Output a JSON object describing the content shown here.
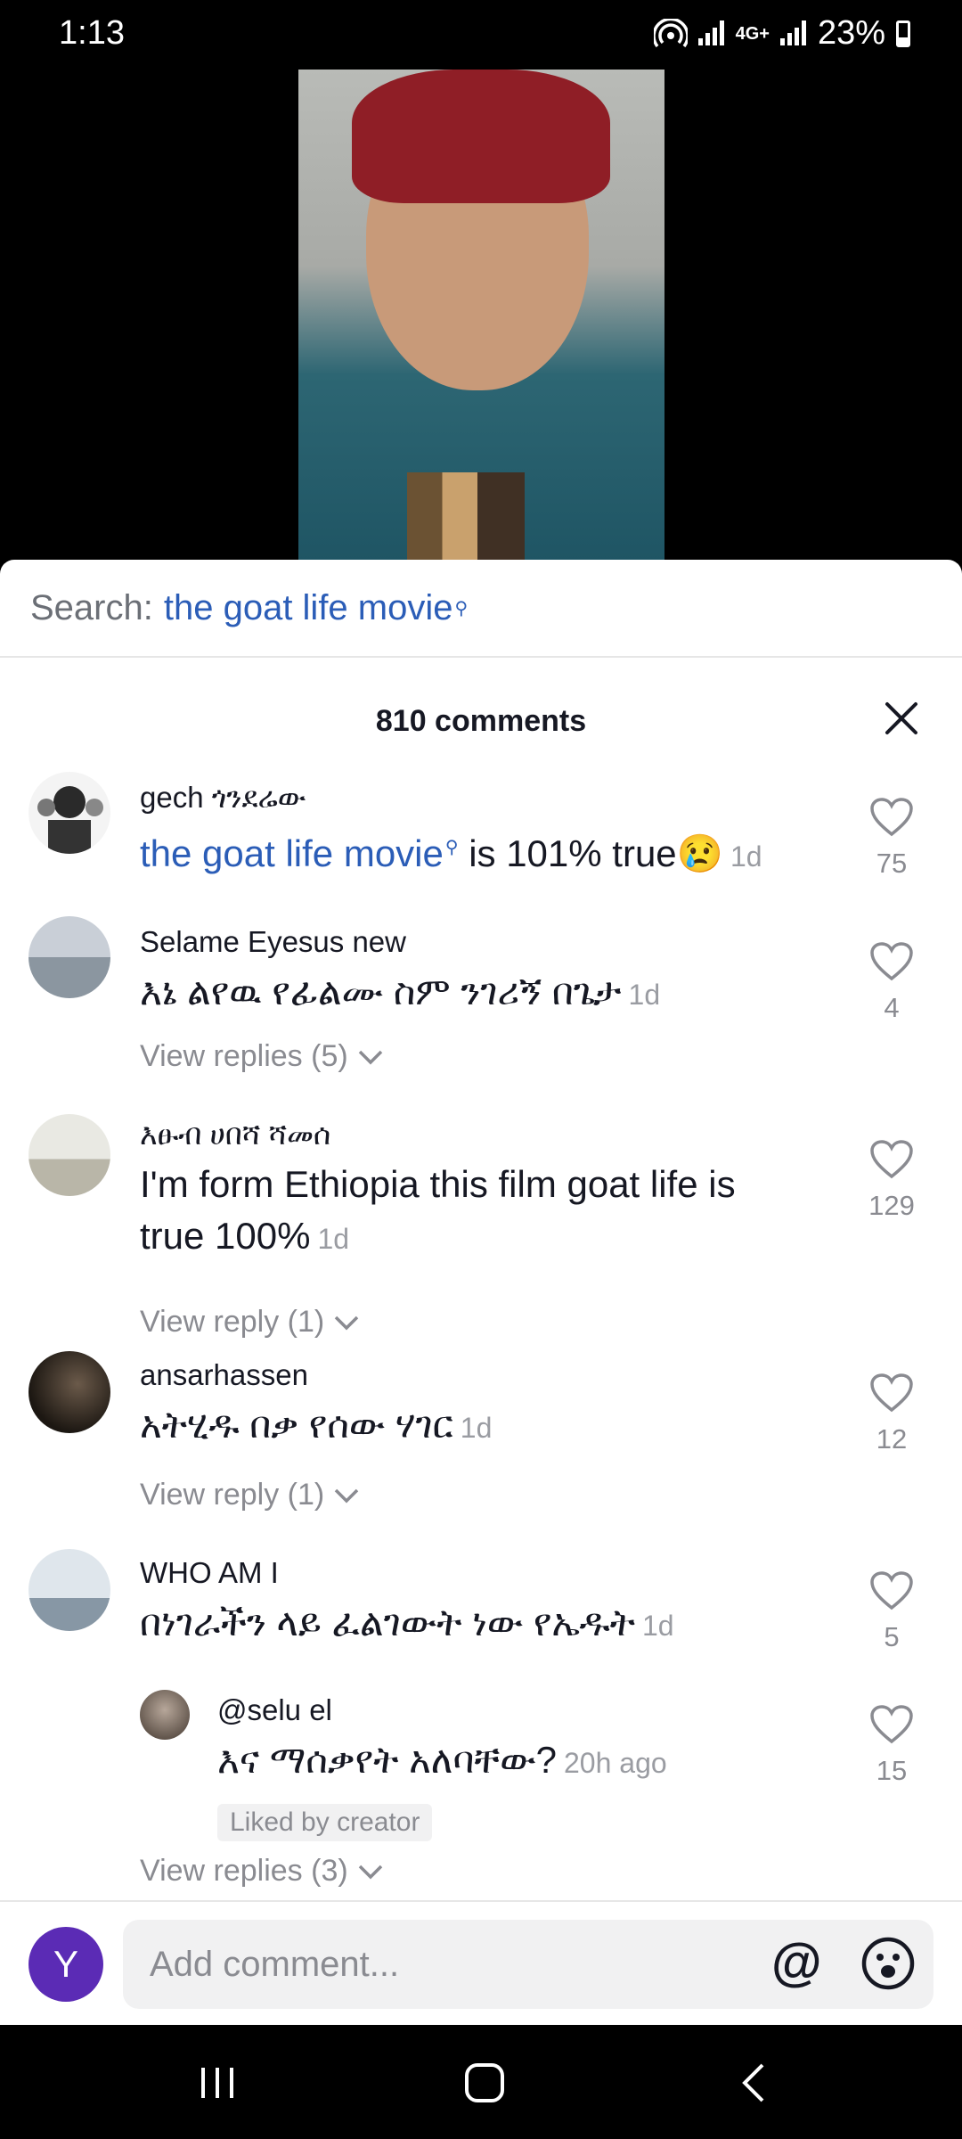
{
  "status_bar": {
    "time": "1:13",
    "network": "4G+",
    "battery": "23%"
  },
  "search": {
    "label": "Search:",
    "query": "the goat life movie"
  },
  "comments_header": {
    "count": "810 comments"
  },
  "comments": [
    {
      "user": "gech ጎንደሬው",
      "link": "the goat life movie",
      "text": " is 101% true😢",
      "time": "1d",
      "likes": "75"
    },
    {
      "user": "Selame Eyesus new",
      "text": "እኔ ልየዉ የፊልሙ ስም ንገሪኝ በጌታ",
      "time": "1d",
      "likes": "4",
      "replies": "View replies (5)"
    },
    {
      "user": "እፁብ ሀበሻ ሻመሰ",
      "text": "I'm form Ethiopia this film goat life is true 100%",
      "time": "1d",
      "likes": "129",
      "replies": "View reply (1)"
    },
    {
      "user": "ansarhassen",
      "text": "አትሂዱ በቃ የሰው ሃገር",
      "time": "1d",
      "likes": "12",
      "replies": "View reply (1)"
    },
    {
      "user": "WHO AM I",
      "text": "በነገራችን ላይ ፈልገውት ነው የኤዱት",
      "time": "1d",
      "likes": "5"
    },
    {
      "user": "@selu el",
      "text": "እና ማሰቃየት አለባቸው?",
      "time": "20h ago",
      "likes": "15",
      "badge": "Liked by creator",
      "replies": "View replies (3)"
    }
  ],
  "composer": {
    "avatar_letter": "Y",
    "placeholder": "Add comment...",
    "at_symbol": "@"
  },
  "colors": {
    "link": "#2b5db7",
    "avatar": "#5b2bb5"
  }
}
